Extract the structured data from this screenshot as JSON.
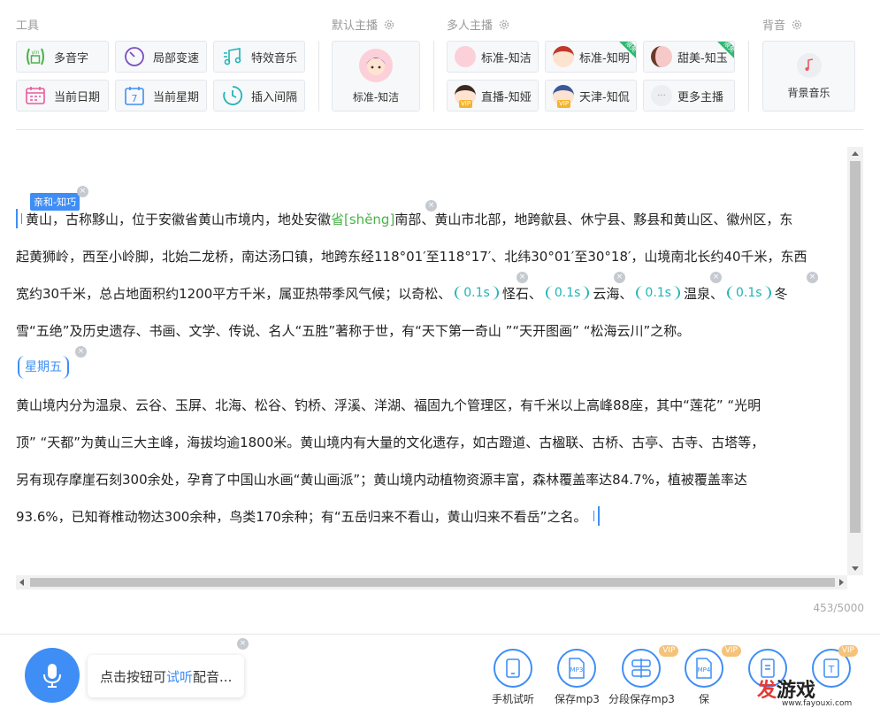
{
  "sections": {
    "tools": "工具",
    "default_anchor": "默认主播",
    "multi_anchor": "多人主播",
    "bgm": "背音"
  },
  "tools": [
    {
      "label": "多音字",
      "icon": "polyphone-icon"
    },
    {
      "label": "局部变速",
      "icon": "speed-icon"
    },
    {
      "label": "特效音乐",
      "icon": "music-note-icon"
    },
    {
      "label": "当前日期",
      "icon": "calendar-icon"
    },
    {
      "label": "当前星期",
      "icon": "week-calendar-icon"
    },
    {
      "label": "插入间隔",
      "icon": "clock-icon"
    }
  ],
  "tool_icon_text": {
    "yin": "yin",
    "week_num": "7"
  },
  "default_voice": {
    "label": "标准-知洁"
  },
  "voices": [
    {
      "label": "标准-知洁",
      "vip": false,
      "new": false
    },
    {
      "label": "标准-知明",
      "vip": false,
      "new": true
    },
    {
      "label": "甜美-知玉",
      "vip": false,
      "new": true
    },
    {
      "label": "直播-知娅",
      "vip": true,
      "new": false
    },
    {
      "label": "天津-知侃",
      "vip": true,
      "new": false
    },
    {
      "label": "更多主播",
      "vip": false,
      "new": false
    }
  ],
  "badges": {
    "vip": "VIP",
    "new": "限免"
  },
  "bgm": {
    "label": "背景音乐"
  },
  "editor": {
    "voice_tag": "亲和-知巧",
    "close_glyph": "×",
    "line1_a": "黄山，古称黟山，位于安徽省黄山市境内，地处安徽",
    "poly_word": "省[shěng]",
    "line1_b": "南部、黄山市北部，地跨歙县、休宁县、黟县和黄山区、徽州区，东",
    "line2": "起黄狮岭，西至小岭脚，北始二龙桥，南达汤口镇，地跨东经118°01′至118°17′、北纬30°01′至30°18′，山境南北长约40千米，东西",
    "line3_a": "宽约30千米，总占地面积约1200平方千米，属亚热带季风气候；以奇松、",
    "pause": "0.1s",
    "line3_b": "怪石、",
    "line3_c": "云海、",
    "line3_d": "温泉、",
    "line3_e": "冬",
    "line4": "雪“五绝”及历史遗存、书画、文学、传说、名人“五胜”著称于世，有“天下第一奇山 ”“天开图画” “松海云川”之称。",
    "weekday": "星期五",
    "line5": "黄山境内分为温泉、云谷、玉屏、北海、松谷、钓桥、浮溪、洋湖、福固九个管理区，有千米以上高峰88座，其中“莲花” “光明",
    "line6": "顶” “天都”为黄山三大主峰，海拔均逾1800米。黄山境内有大量的文化遗存，如古蹬道、古楹联、古桥、古亭、古寺、古塔等，",
    "line7": "另有现存摩崖石刻300余处，孕育了中国山水画“黄山画派”；黄山境内动植物资源丰富，森林覆盖率达84.7%，植被覆盖率达",
    "line8": "93.6%，已知脊椎动物达300余种，鸟类170余种；有“五岳归来不看山，黄山归来不看岳”之名。"
  },
  "counter": "453/5000",
  "hint": {
    "a": "点击按钮可",
    "b": "试听",
    "c": "配音..."
  },
  "actions": [
    {
      "label": "手机试听",
      "icon": "phone-icon",
      "vip": false,
      "text": ""
    },
    {
      "label": "保存mp3",
      "icon": "mp3-file-icon",
      "vip": false,
      "text": "MP3"
    },
    {
      "label": "分段保存mp3",
      "icon": "segment-save-icon",
      "vip": true,
      "text": ""
    },
    {
      "label": "保",
      "icon": "mp4-file-icon",
      "vip": true,
      "text": "MP4"
    },
    {
      "label": "",
      "icon": "text-file-icon",
      "vip": false,
      "text": ""
    },
    {
      "label": "",
      "icon": "text-t-icon",
      "vip": true,
      "text": "T"
    }
  ],
  "watermark": {
    "main_a": "发",
    "main_b": "游戏",
    "sub": "www.fayouxi.com"
  },
  "colors": {
    "accent": "#3f8ef5",
    "pause": "#22b4b6",
    "poly": "#4ab34a",
    "vip": "#f5b42a",
    "new": "#2eb872"
  }
}
